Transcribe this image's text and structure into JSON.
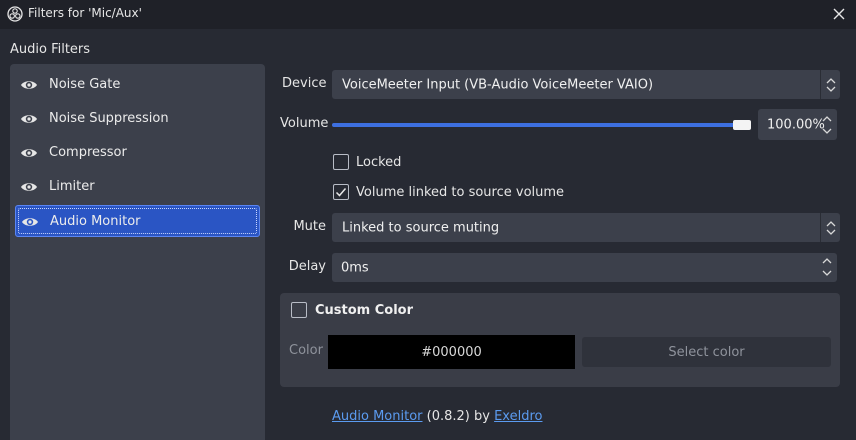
{
  "window": {
    "title": "Filters for 'Mic/Aux'",
    "icon": "obs-logo-icon",
    "close_icon": "close-icon"
  },
  "filters_panel": {
    "heading": "Audio Filters",
    "items": [
      {
        "label": "Noise Gate",
        "icon": "eye-icon",
        "selected": false
      },
      {
        "label": "Noise Suppression",
        "icon": "eye-icon",
        "selected": false
      },
      {
        "label": "Compressor",
        "icon": "eye-icon",
        "selected": false
      },
      {
        "label": "Limiter",
        "icon": "eye-icon",
        "selected": false
      },
      {
        "label": "Audio Monitor",
        "icon": "eye-icon",
        "selected": true
      }
    ]
  },
  "properties": {
    "device": {
      "label": "Device",
      "value": "VoiceMeeter Input (VB-Audio VoiceMeeter VAIO)"
    },
    "volume": {
      "label": "Volume",
      "value": "100.00%",
      "slider_fraction": 1.0
    },
    "locked": {
      "label": "Locked",
      "checked": false
    },
    "volume_linked": {
      "label": "Volume linked to source volume",
      "checked": true
    },
    "mute": {
      "label": "Mute",
      "value": "Linked to source muting"
    },
    "delay": {
      "label": "Delay",
      "value": "0ms"
    },
    "custom_color": {
      "label": "Custom Color",
      "checked": false,
      "color_label": "Color",
      "color_value": "#000000",
      "select_button": "Select color"
    }
  },
  "footer": {
    "plugin_name": "Audio Monitor",
    "version_text": "(0.8.2) by",
    "author": "Exeldro"
  },
  "colors": {
    "background": "#272a33",
    "panel": "#3c404b",
    "accent": "#2a55c4",
    "slider": "#3d6fe0",
    "link": "#5b9bf0"
  }
}
